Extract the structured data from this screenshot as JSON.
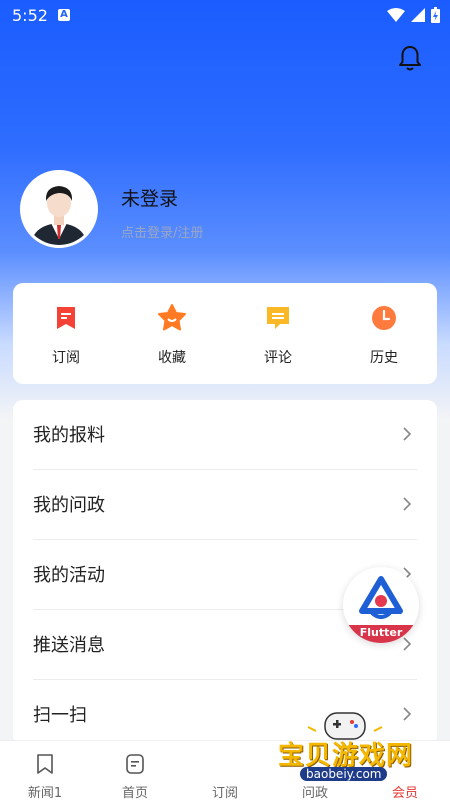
{
  "status": {
    "time": "5:52",
    "app_badge": "A"
  },
  "profile": {
    "name": "未登录",
    "login_prompt": "点击登录/注册"
  },
  "quick_actions": [
    {
      "label": "订阅",
      "icon": "subscribe-icon",
      "color": "#f44336"
    },
    {
      "label": "收藏",
      "icon": "star-icon",
      "color": "#ff7a22"
    },
    {
      "label": "评论",
      "icon": "comment-icon",
      "color": "#fbb826"
    },
    {
      "label": "历史",
      "icon": "clock-icon",
      "color": "#ff7a3d"
    }
  ],
  "menu": [
    {
      "label": "我的报料"
    },
    {
      "label": "我的问政"
    },
    {
      "label": "我的活动"
    },
    {
      "label": "推送消息"
    },
    {
      "label": "扫一扫"
    }
  ],
  "floating_badge": {
    "label": "Flutter"
  },
  "tabs": [
    {
      "label": "新闻1",
      "icon": "bookmark-icon"
    },
    {
      "label": "首页",
      "icon": "document-icon"
    },
    {
      "label": "订阅",
      "icon": "subscribe-icon"
    },
    {
      "label": "问政",
      "icon": "question-icon"
    },
    {
      "label": "会员",
      "icon": "member-icon",
      "active": true
    }
  ],
  "watermark": {
    "title": "宝贝游戏网",
    "domain": "baobeiy.com"
  },
  "colors": {
    "accent": "#1a5cff",
    "active_tab": "#e53935"
  }
}
